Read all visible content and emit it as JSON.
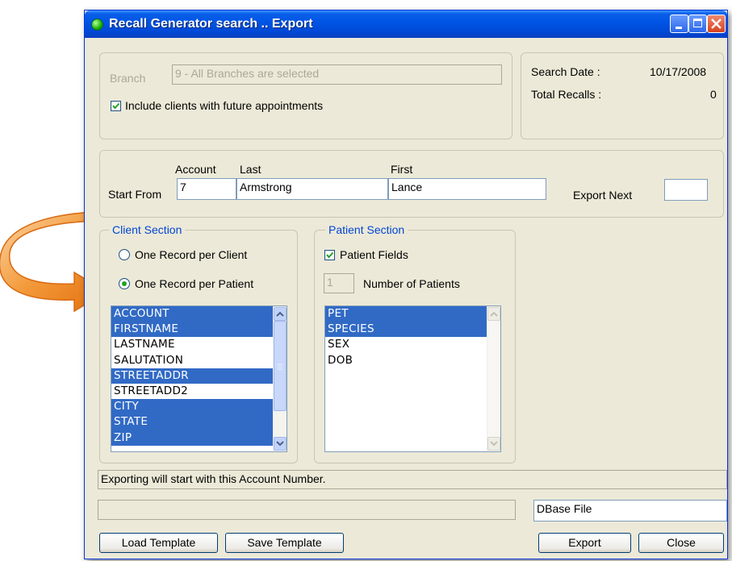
{
  "window": {
    "title": "Recall Generator search .. Export"
  },
  "branch": {
    "label": "Branch",
    "value": "9  -  All Branches are selected",
    "include_future_label": "Include clients with future appointments",
    "include_future_checked": true
  },
  "search_info": {
    "search_date_label": "Search Date :",
    "search_date_value": "10/17/2008",
    "total_recalls_label": "Total Recalls :",
    "total_recalls_value": "0"
  },
  "start_from": {
    "label": "Start From",
    "account_header": "Account",
    "last_header": "Last",
    "first_header": "First",
    "account_value": "7",
    "last_value": "Armstrong",
    "first_value": "Lance",
    "export_next_label": "Export Next",
    "export_next_value": ""
  },
  "client_section": {
    "title": "Client Section",
    "option_client": "One Record per Client",
    "option_patient": "One Record per Patient",
    "selected_option": "One Record per Patient",
    "fields": [
      {
        "label": "ACCOUNT",
        "selected": true
      },
      {
        "label": "FIRSTNAME",
        "selected": true
      },
      {
        "label": "LASTNAME",
        "selected": false
      },
      {
        "label": "SALUTATION",
        "selected": false
      },
      {
        "label": "STREETADDR",
        "selected": true
      },
      {
        "label": "STREETADD2",
        "selected": false
      },
      {
        "label": "CITY",
        "selected": true
      },
      {
        "label": "STATE",
        "selected": true
      },
      {
        "label": "ZIP",
        "selected": true
      }
    ]
  },
  "patient_section": {
    "title": "Patient Section",
    "patient_fields_label": "Patient Fields",
    "patient_fields_checked": true,
    "num_patients_value": "1",
    "num_patients_label": "Number of Patients",
    "fields": [
      {
        "label": "PET",
        "selected": true
      },
      {
        "label": "SPECIES",
        "selected": true
      },
      {
        "label": "SEX",
        "selected": false
      },
      {
        "label": "DOB",
        "selected": false
      }
    ]
  },
  "status": {
    "message": "Exporting will start with this Account Number.",
    "progress_text": "",
    "file_type": "DBase File"
  },
  "buttons": {
    "load_template": "Load Template",
    "save_template": "Save Template",
    "export": "Export",
    "close": "Close"
  },
  "colors": {
    "title_bar": "#0055e5",
    "selection": "#316ac5",
    "group_title": "#0046d5",
    "arrow": "#f08a1e"
  }
}
